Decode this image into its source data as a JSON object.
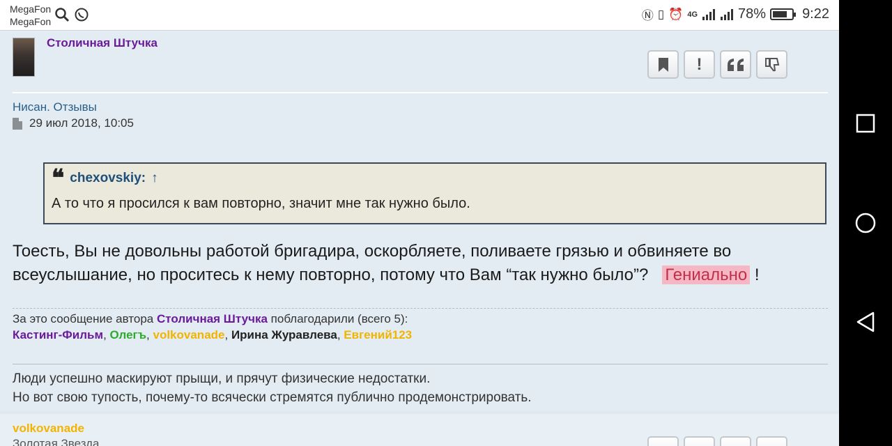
{
  "status_bar": {
    "carrier1": "MegaFon",
    "carrier2": "MegaFon",
    "battery_percent": "78%",
    "battery_level": 0.78,
    "time": "9:22",
    "network": "4G"
  },
  "post": {
    "author": "Столичная Штучка",
    "topic": "Нисан. Отзывы",
    "date": "29 июл 2018, 10:05",
    "quote": {
      "author": "chexovskiy:",
      "arrow": "↑",
      "text": "А то что я просился к вам повторно, значит мне так нужно было."
    },
    "body_line1": "Тоесть, Вы не довольны работой бригадира, оскорбляете, поливаете грязью и обвиняете во",
    "body_line2": "всеуслышание, но проситесь к нему повторно, потому что Вам “так нужно было”?",
    "highlight": "Гениально",
    "exclaim": "!",
    "thanks": {
      "prefix": "За это сообщение автора",
      "author": "Столичная Штучка",
      "suffix": "поблагодарили (всего 5):",
      "users": [
        {
          "name": "Кастинг-Фильм",
          "color": "#6a1b9a"
        },
        {
          "name": "Олегъ",
          "color": "#2eaa2e"
        },
        {
          "name": "volkovanade",
          "color": "#f2b400"
        },
        {
          "name": "Ирина Журавлева",
          "color": "#222222"
        },
        {
          "name": "Евгений123",
          "color": "#f2b400"
        }
      ]
    },
    "signature_line1": "Люди успешно маскируют прыщи, и прячут физические недостатки.",
    "signature_line2": "Но вот свою тупость, почему-то всячески стремятся публично продемонстрировать."
  },
  "post2": {
    "author": "volkovanade",
    "rank": "Золотая Звезда"
  },
  "actions": {
    "bookmark": "bookmark-icon",
    "report": "!",
    "quote": "❝",
    "dislike": "thumb-down-icon"
  }
}
